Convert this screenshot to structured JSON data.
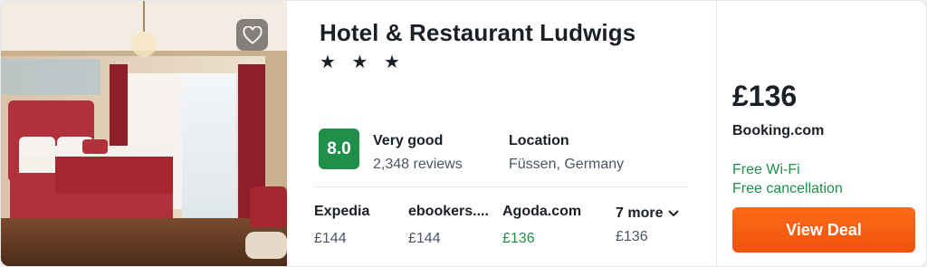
{
  "hotel": {
    "name": "Hotel & Restaurant Ludwigs",
    "stars_text": "★ ★ ★",
    "star_count": 3
  },
  "rating": {
    "score": "8.0",
    "label": "Very good",
    "reviews": "2,348 reviews"
  },
  "location": {
    "label": "Location",
    "value": "Füssen, Germany"
  },
  "providers": [
    {
      "name": "Expedia",
      "price": "£144"
    },
    {
      "name": "ebookers....",
      "price": "£144"
    },
    {
      "name": "Agoda.com",
      "price": "£136"
    }
  ],
  "more": {
    "label": "7 more",
    "price": "£136"
  },
  "deal": {
    "price": "£136",
    "vendor": "Booking.com",
    "perks": [
      "Free Wi-Fi",
      "Free cancellation"
    ],
    "button_label": "View Deal"
  },
  "icons": {
    "favorite": "heart-icon",
    "expand": "chevron-down-icon"
  },
  "colors": {
    "score_badge": "#1f8f4b",
    "best_price": "#1f8f4b",
    "perk_text": "#1f8f4b",
    "deal_button": "#f0530a"
  }
}
